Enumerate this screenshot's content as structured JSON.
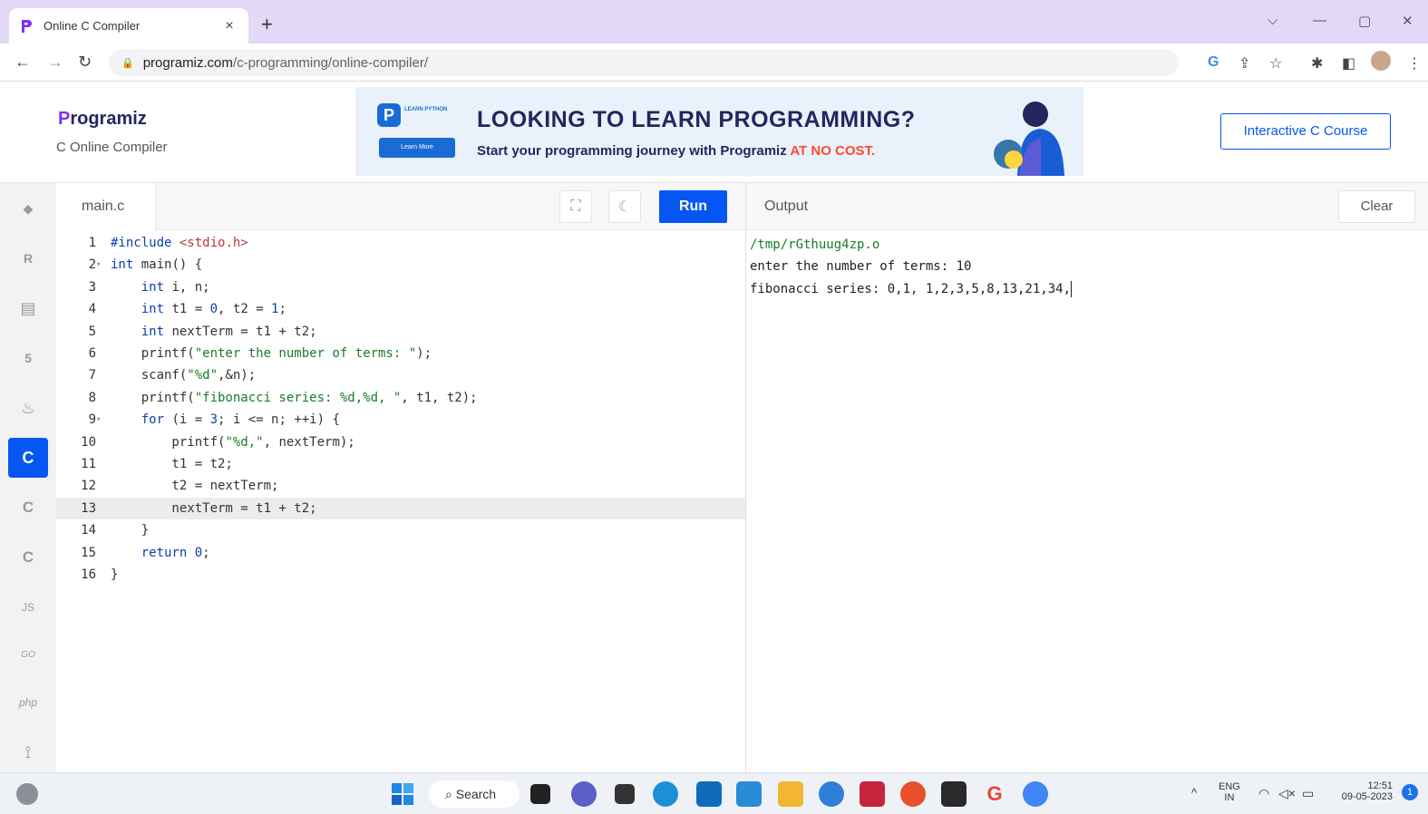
{
  "browser": {
    "tab_title": "Online C Compiler",
    "tab_close": "×",
    "new_tab": "+",
    "url_host": "programiz.com",
    "url_path": "/c-programming/online-compiler/"
  },
  "site": {
    "logo": "rogramiz",
    "logo_p": "P",
    "subtitle": "C Online Compiler",
    "banner_headline": "LOOKING TO LEARN PROGRAMMING?",
    "banner_sub": "Start your programming journey with Programiz ",
    "banner_sub_highlight": "AT NO COST.",
    "banner_mini_label": "LEARN PYTHON",
    "banner_mini_button": "Learn More",
    "course_button": "Interactive C Course"
  },
  "rail": {
    "items": [
      {
        "icon": "python-icon",
        "glyph": "◆"
      },
      {
        "icon": "r-icon",
        "glyph": "R"
      },
      {
        "icon": "sql-icon",
        "glyph": "▤"
      },
      {
        "icon": "html-icon",
        "glyph": "5"
      },
      {
        "icon": "java-icon",
        "glyph": "♨"
      },
      {
        "icon": "c-icon",
        "glyph": "C"
      },
      {
        "icon": "cpp-icon",
        "glyph": "C"
      },
      {
        "icon": "csharp-icon",
        "glyph": "C"
      },
      {
        "icon": "js-icon",
        "glyph": "JS"
      },
      {
        "icon": "go-icon",
        "glyph": "GO"
      },
      {
        "icon": "php-icon",
        "glyph": "php"
      },
      {
        "icon": "swift-icon",
        "glyph": "⟟"
      }
    ]
  },
  "editor": {
    "filename": "main.c",
    "run_label": "Run"
  },
  "output": {
    "title": "Output",
    "clear_label": "Clear",
    "lines": [
      "/tmp/rGthuug4zp.o",
      "enter the number of terms: 10",
      "fibonacci series: 0,1, 1,2,3,5,8,13,21,34,"
    ]
  },
  "taskbar": {
    "search_label": "Search",
    "lang_top": "ENG",
    "lang_bottom": "IN",
    "time": "12:51",
    "date": "09-05-2023",
    "notif_count": "1"
  },
  "colors": {
    "accent": "#0556f3",
    "tabstrip": "#e3d8f6",
    "brand": "#25265e",
    "highlight": "#ff4a2f"
  }
}
